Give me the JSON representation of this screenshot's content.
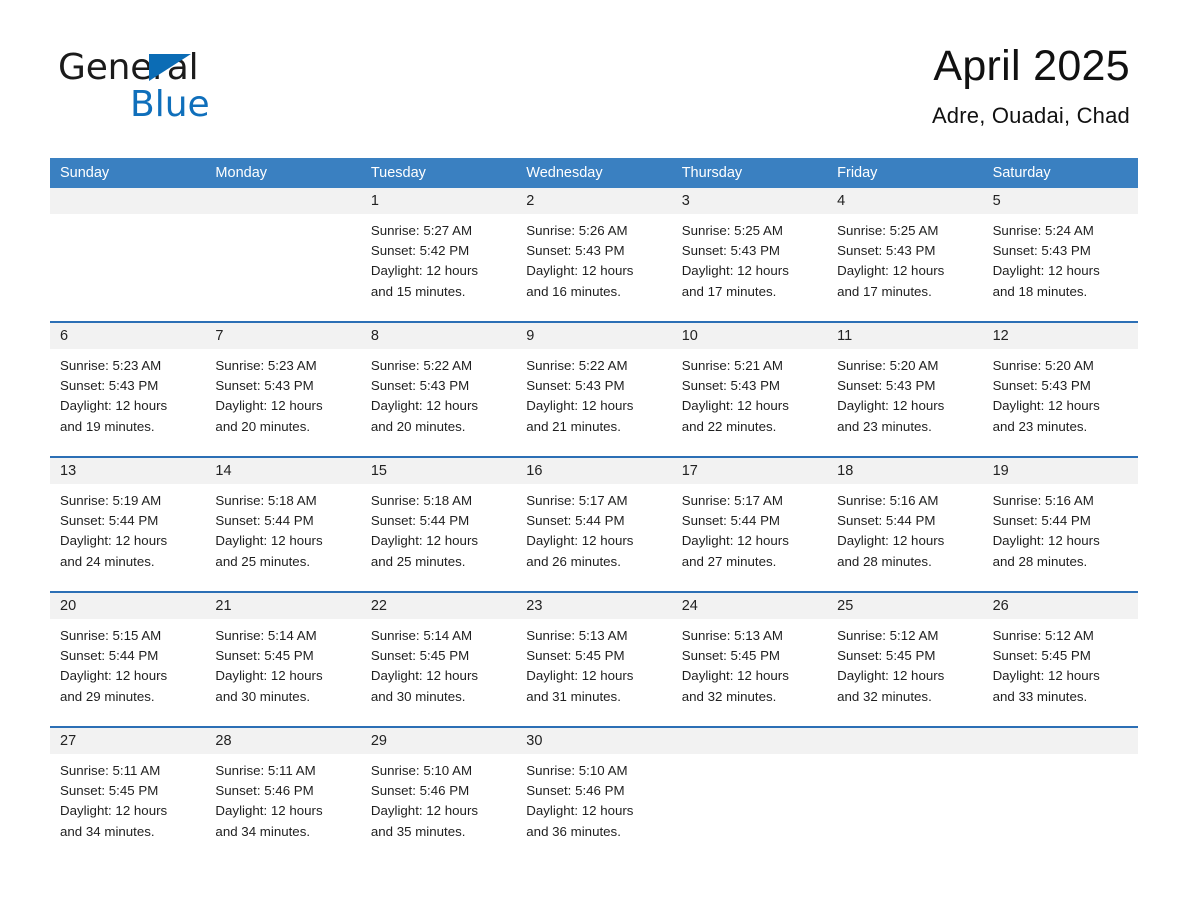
{
  "brand": {
    "name_part1": "General",
    "name_part2": "Blue",
    "triangle_icon": "blue-triangle-icon"
  },
  "header": {
    "title": "April 2025",
    "subtitle": "Adre, Ouadai, Chad"
  },
  "colors": {
    "header_blue": "#3a80c1",
    "row_divider_blue": "#2c6fb5",
    "date_strip_gray": "#f2f2f2",
    "brand_blue": "#0f6fbb",
    "text": "#1f1f1f"
  },
  "weekdays": [
    "Sunday",
    "Monday",
    "Tuesday",
    "Wednesday",
    "Thursday",
    "Friday",
    "Saturday"
  ],
  "weeks": [
    [
      {
        "day": "",
        "sunrise": "",
        "sunset": "",
        "daylight_line1": "",
        "daylight_line2": "",
        "empty": true
      },
      {
        "day": "",
        "sunrise": "",
        "sunset": "",
        "daylight_line1": "",
        "daylight_line2": "",
        "empty": true
      },
      {
        "day": "1",
        "sunrise": "Sunrise: 5:27 AM",
        "sunset": "Sunset: 5:42 PM",
        "daylight_line1": "Daylight: 12 hours",
        "daylight_line2": "and 15 minutes."
      },
      {
        "day": "2",
        "sunrise": "Sunrise: 5:26 AM",
        "sunset": "Sunset: 5:43 PM",
        "daylight_line1": "Daylight: 12 hours",
        "daylight_line2": "and 16 minutes."
      },
      {
        "day": "3",
        "sunrise": "Sunrise: 5:25 AM",
        "sunset": "Sunset: 5:43 PM",
        "daylight_line1": "Daylight: 12 hours",
        "daylight_line2": "and 17 minutes."
      },
      {
        "day": "4",
        "sunrise": "Sunrise: 5:25 AM",
        "sunset": "Sunset: 5:43 PM",
        "daylight_line1": "Daylight: 12 hours",
        "daylight_line2": "and 17 minutes."
      },
      {
        "day": "5",
        "sunrise": "Sunrise: 5:24 AM",
        "sunset": "Sunset: 5:43 PM",
        "daylight_line1": "Daylight: 12 hours",
        "daylight_line2": "and 18 minutes."
      }
    ],
    [
      {
        "day": "6",
        "sunrise": "Sunrise: 5:23 AM",
        "sunset": "Sunset: 5:43 PM",
        "daylight_line1": "Daylight: 12 hours",
        "daylight_line2": "and 19 minutes."
      },
      {
        "day": "7",
        "sunrise": "Sunrise: 5:23 AM",
        "sunset": "Sunset: 5:43 PM",
        "daylight_line1": "Daylight: 12 hours",
        "daylight_line2": "and 20 minutes."
      },
      {
        "day": "8",
        "sunrise": "Sunrise: 5:22 AM",
        "sunset": "Sunset: 5:43 PM",
        "daylight_line1": "Daylight: 12 hours",
        "daylight_line2": "and 20 minutes."
      },
      {
        "day": "9",
        "sunrise": "Sunrise: 5:22 AM",
        "sunset": "Sunset: 5:43 PM",
        "daylight_line1": "Daylight: 12 hours",
        "daylight_line2": "and 21 minutes."
      },
      {
        "day": "10",
        "sunrise": "Sunrise: 5:21 AM",
        "sunset": "Sunset: 5:43 PM",
        "daylight_line1": "Daylight: 12 hours",
        "daylight_line2": "and 22 minutes."
      },
      {
        "day": "11",
        "sunrise": "Sunrise: 5:20 AM",
        "sunset": "Sunset: 5:43 PM",
        "daylight_line1": "Daylight: 12 hours",
        "daylight_line2": "and 23 minutes."
      },
      {
        "day": "12",
        "sunrise": "Sunrise: 5:20 AM",
        "sunset": "Sunset: 5:43 PM",
        "daylight_line1": "Daylight: 12 hours",
        "daylight_line2": "and 23 minutes."
      }
    ],
    [
      {
        "day": "13",
        "sunrise": "Sunrise: 5:19 AM",
        "sunset": "Sunset: 5:44 PM",
        "daylight_line1": "Daylight: 12 hours",
        "daylight_line2": "and 24 minutes."
      },
      {
        "day": "14",
        "sunrise": "Sunrise: 5:18 AM",
        "sunset": "Sunset: 5:44 PM",
        "daylight_line1": "Daylight: 12 hours",
        "daylight_line2": "and 25 minutes."
      },
      {
        "day": "15",
        "sunrise": "Sunrise: 5:18 AM",
        "sunset": "Sunset: 5:44 PM",
        "daylight_line1": "Daylight: 12 hours",
        "daylight_line2": "and 25 minutes."
      },
      {
        "day": "16",
        "sunrise": "Sunrise: 5:17 AM",
        "sunset": "Sunset: 5:44 PM",
        "daylight_line1": "Daylight: 12 hours",
        "daylight_line2": "and 26 minutes."
      },
      {
        "day": "17",
        "sunrise": "Sunrise: 5:17 AM",
        "sunset": "Sunset: 5:44 PM",
        "daylight_line1": "Daylight: 12 hours",
        "daylight_line2": "and 27 minutes."
      },
      {
        "day": "18",
        "sunrise": "Sunrise: 5:16 AM",
        "sunset": "Sunset: 5:44 PM",
        "daylight_line1": "Daylight: 12 hours",
        "daylight_line2": "and 28 minutes."
      },
      {
        "day": "19",
        "sunrise": "Sunrise: 5:16 AM",
        "sunset": "Sunset: 5:44 PM",
        "daylight_line1": "Daylight: 12 hours",
        "daylight_line2": "and 28 minutes."
      }
    ],
    [
      {
        "day": "20",
        "sunrise": "Sunrise: 5:15 AM",
        "sunset": "Sunset: 5:44 PM",
        "daylight_line1": "Daylight: 12 hours",
        "daylight_line2": "and 29 minutes."
      },
      {
        "day": "21",
        "sunrise": "Sunrise: 5:14 AM",
        "sunset": "Sunset: 5:45 PM",
        "daylight_line1": "Daylight: 12 hours",
        "daylight_line2": "and 30 minutes."
      },
      {
        "day": "22",
        "sunrise": "Sunrise: 5:14 AM",
        "sunset": "Sunset: 5:45 PM",
        "daylight_line1": "Daylight: 12 hours",
        "daylight_line2": "and 30 minutes."
      },
      {
        "day": "23",
        "sunrise": "Sunrise: 5:13 AM",
        "sunset": "Sunset: 5:45 PM",
        "daylight_line1": "Daylight: 12 hours",
        "daylight_line2": "and 31 minutes."
      },
      {
        "day": "24",
        "sunrise": "Sunrise: 5:13 AM",
        "sunset": "Sunset: 5:45 PM",
        "daylight_line1": "Daylight: 12 hours",
        "daylight_line2": "and 32 minutes."
      },
      {
        "day": "25",
        "sunrise": "Sunrise: 5:12 AM",
        "sunset": "Sunset: 5:45 PM",
        "daylight_line1": "Daylight: 12 hours",
        "daylight_line2": "and 32 minutes."
      },
      {
        "day": "26",
        "sunrise": "Sunrise: 5:12 AM",
        "sunset": "Sunset: 5:45 PM",
        "daylight_line1": "Daylight: 12 hours",
        "daylight_line2": "and 33 minutes."
      }
    ],
    [
      {
        "day": "27",
        "sunrise": "Sunrise: 5:11 AM",
        "sunset": "Sunset: 5:45 PM",
        "daylight_line1": "Daylight: 12 hours",
        "daylight_line2": "and 34 minutes."
      },
      {
        "day": "28",
        "sunrise": "Sunrise: 5:11 AM",
        "sunset": "Sunset: 5:46 PM",
        "daylight_line1": "Daylight: 12 hours",
        "daylight_line2": "and 34 minutes."
      },
      {
        "day": "29",
        "sunrise": "Sunrise: 5:10 AM",
        "sunset": "Sunset: 5:46 PM",
        "daylight_line1": "Daylight: 12 hours",
        "daylight_line2": "and 35 minutes."
      },
      {
        "day": "30",
        "sunrise": "Sunrise: 5:10 AM",
        "sunset": "Sunset: 5:46 PM",
        "daylight_line1": "Daylight: 12 hours",
        "daylight_line2": "and 36 minutes."
      },
      {
        "day": "",
        "sunrise": "",
        "sunset": "",
        "daylight_line1": "",
        "daylight_line2": "",
        "empty": true
      },
      {
        "day": "",
        "sunrise": "",
        "sunset": "",
        "daylight_line1": "",
        "daylight_line2": "",
        "empty": true
      },
      {
        "day": "",
        "sunrise": "",
        "sunset": "",
        "daylight_line1": "",
        "daylight_line2": "",
        "empty": true
      }
    ]
  ]
}
